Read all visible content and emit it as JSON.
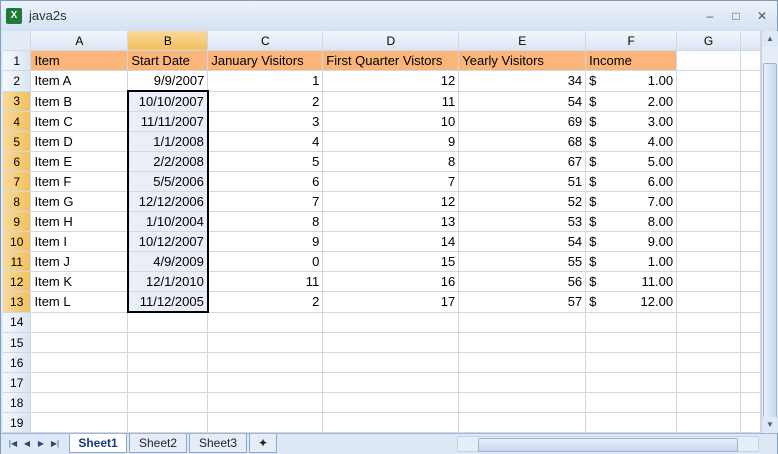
{
  "window": {
    "title": "java2s",
    "app_icon": "X",
    "controls": [
      "–",
      "□",
      "✕"
    ]
  },
  "sheet": {
    "columns": [
      "A",
      "B",
      "C",
      "D",
      "E",
      "F",
      "G"
    ],
    "selected_column": "B",
    "selected_rows": [
      3,
      4,
      5,
      6,
      7,
      8,
      9,
      10,
      11,
      12,
      13
    ],
    "header_row": [
      "Item",
      "Start Date",
      "January Visitors",
      "First Quarter Vistors",
      "Yearly Visitors",
      "Income",
      ""
    ],
    "rows": [
      {
        "item": "Item A",
        "date": "9/9/2007",
        "jan": "1",
        "q1": "12",
        "year": "34",
        "cur": "$",
        "inc": "1.00"
      },
      {
        "item": "Item B",
        "date": "10/10/2007",
        "jan": "2",
        "q1": "11",
        "year": "54",
        "cur": "$",
        "inc": "2.00"
      },
      {
        "item": "Item C",
        "date": "11/11/2007",
        "jan": "3",
        "q1": "10",
        "year": "69",
        "cur": "$",
        "inc": "3.00"
      },
      {
        "item": "Item D",
        "date": "1/1/2008",
        "jan": "4",
        "q1": "9",
        "year": "68",
        "cur": "$",
        "inc": "4.00"
      },
      {
        "item": "Item E",
        "date": "2/2/2008",
        "jan": "5",
        "q1": "8",
        "year": "67",
        "cur": "$",
        "inc": "5.00"
      },
      {
        "item": "Item F",
        "date": "5/5/2006",
        "jan": "6",
        "q1": "7",
        "year": "51",
        "cur": "$",
        "inc": "6.00"
      },
      {
        "item": "Item G",
        "date": "12/12/2006",
        "jan": "7",
        "q1": "12",
        "year": "52",
        "cur": "$",
        "inc": "7.00"
      },
      {
        "item": "Item H",
        "date": "1/10/2004",
        "jan": "8",
        "q1": "13",
        "year": "53",
        "cur": "$",
        "inc": "8.00"
      },
      {
        "item": "Item I",
        "date": "10/12/2007",
        "jan": "9",
        "q1": "14",
        "year": "54",
        "cur": "$",
        "inc": "9.00"
      },
      {
        "item": "Item J",
        "date": "4/9/2009",
        "jan": "0",
        "q1": "15",
        "year": "55",
        "cur": "$",
        "inc": "1.00"
      },
      {
        "item": "Item K",
        "date": "12/1/2010",
        "jan": "11",
        "q1": "16",
        "year": "56",
        "cur": "$",
        "inc": "11.00"
      },
      {
        "item": "Item L",
        "date": "11/12/2005",
        "jan": "2",
        "q1": "17",
        "year": "57",
        "cur": "$",
        "inc": "12.00"
      }
    ],
    "empty_rows": [
      14,
      15,
      16,
      17,
      18,
      19
    ]
  },
  "tabs": [
    "Sheet1",
    "Sheet2",
    "Sheet3"
  ],
  "active_tab": "Sheet1",
  "nav_glyphs": [
    "|◀",
    "◀",
    "▶",
    "▶|"
  ],
  "colors": {
    "header_fill": "#f9b57a",
    "selection_fill": "#eaeef7"
  }
}
